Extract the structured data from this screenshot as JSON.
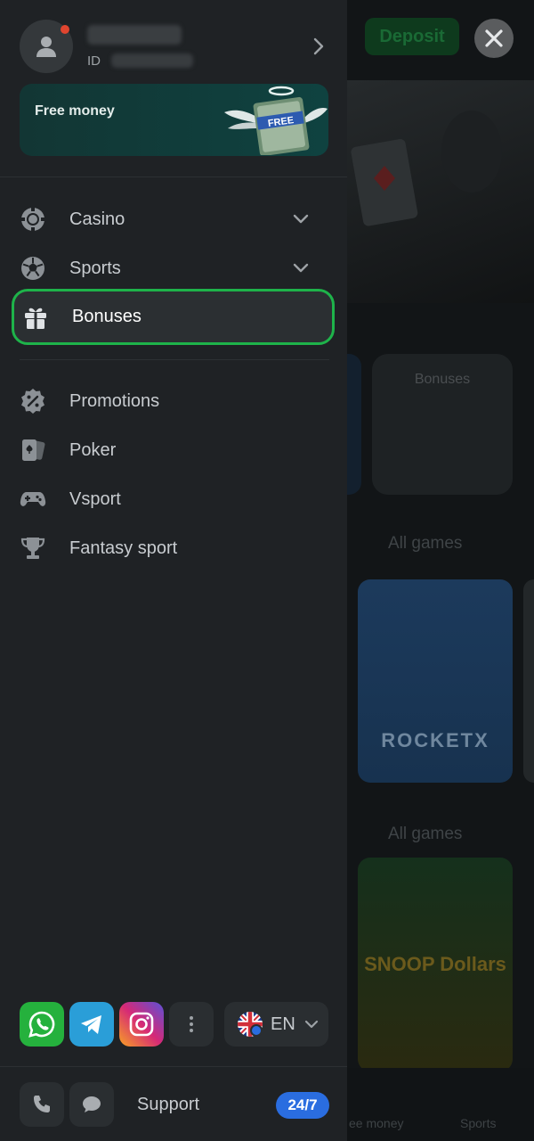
{
  "background": {
    "deposit_label": "Deposit",
    "bonuses_card_label": "Bonuses",
    "all_games_label_1": "All games",
    "all_games_label_2": "All games",
    "rocketx_label": "ROCKETX",
    "snoop_label": "SNOOP Dollars",
    "tab_free_money": "ee money",
    "tab_sports": "Sports"
  },
  "profile": {
    "id_label": "ID",
    "has_notification": true
  },
  "promo_banner": {
    "text": "Free money",
    "art_label": "FREE"
  },
  "menu": {
    "group1": [
      {
        "label": "Casino",
        "icon": "casino-chip-icon",
        "has_chevron": true
      },
      {
        "label": "Sports",
        "icon": "soccer-ball-icon",
        "has_chevron": true
      },
      {
        "label": "Bonuses",
        "icon": "gift-icon",
        "active": true
      }
    ],
    "group2": [
      {
        "label": "Promotions",
        "icon": "percent-badge-icon"
      },
      {
        "label": "Poker",
        "icon": "cards-icon"
      },
      {
        "label": "Vsport",
        "icon": "gamepad-icon"
      },
      {
        "label": "Fantasy sport",
        "icon": "trophy-icon"
      }
    ]
  },
  "socials": [
    {
      "name": "whatsapp",
      "icon": "whatsapp-icon",
      "color": "#25b13d"
    },
    {
      "name": "telegram",
      "icon": "telegram-icon",
      "color": "#2a9ed8"
    },
    {
      "name": "instagram",
      "icon": "instagram-icon",
      "color": "#d62976"
    }
  ],
  "language": {
    "code": "EN",
    "flag": "uk-flag-icon"
  },
  "support": {
    "label": "Support",
    "badge": "24/7"
  },
  "colors": {
    "accent_green": "#1eb34a",
    "badge_blue": "#2a6de0",
    "drawer_bg": "#1f2225"
  }
}
